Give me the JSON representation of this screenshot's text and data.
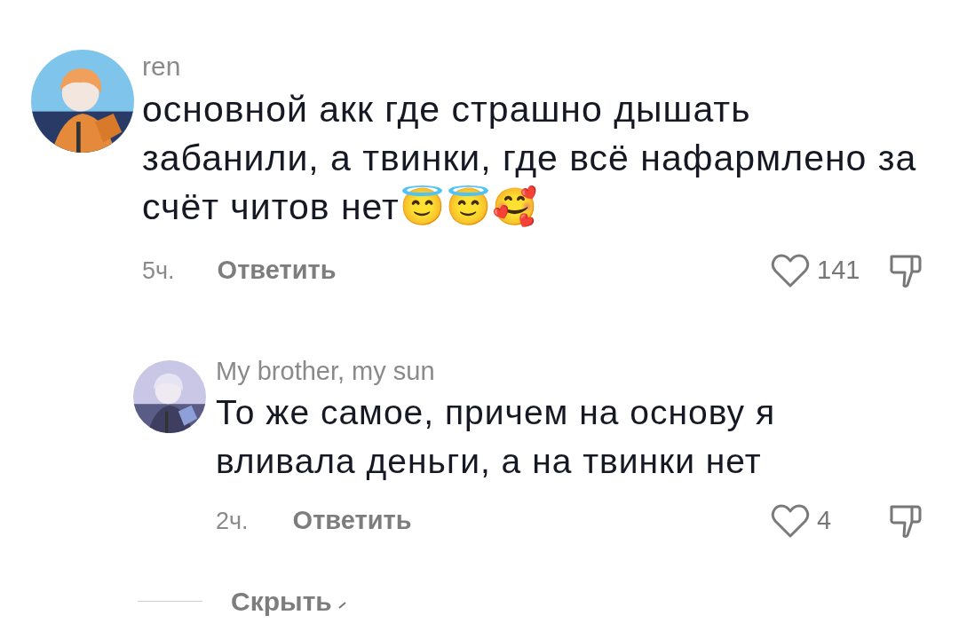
{
  "comments": [
    {
      "username": "ren",
      "text": "основной акк где страшно дышать забанили, а твинки, где всё нафармлено за счёт читов нет😇😇🥰",
      "time": "5ч.",
      "reply_label": "Ответить",
      "likes": "141",
      "liked": false,
      "replies": [
        {
          "username": "My brother, my sun",
          "text": "То же самое, причем на основу я вливала деньги, а на твинки нет",
          "time": "2ч.",
          "reply_label": "Ответить",
          "likes": "4",
          "liked": false
        }
      ]
    }
  ],
  "hide_label": "Скрыть"
}
